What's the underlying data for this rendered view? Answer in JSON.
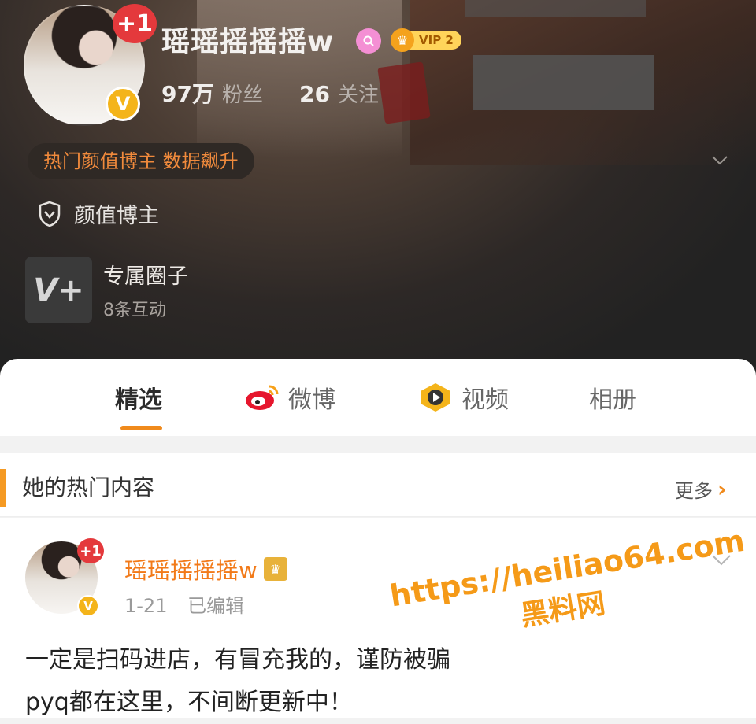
{
  "profile": {
    "username": "瑶瑶摇摇摇w",
    "plus_badge": "+1",
    "verified_badge": "V",
    "vip_label": "VIP 2",
    "fans_count": "97万",
    "fans_label": "粉丝",
    "following_count": "26",
    "following_label": "关注",
    "hot_tag": "热门颜值博主 数据飙升",
    "certification": "颜值博主",
    "circle_title": "专属圈子",
    "circle_sub": "8条互动",
    "circle_icon": "V+",
    "icons": [
      "search-badge-icon",
      "vip-crown-icon",
      "shield-icon",
      "chevron-down-icon"
    ]
  },
  "tabs": [
    {
      "label": "精选",
      "icon": ""
    },
    {
      "label": "微博",
      "icon": "weibo-icon"
    },
    {
      "label": "视频",
      "icon": "video-icon"
    },
    {
      "label": "相册",
      "icon": ""
    }
  ],
  "section": {
    "title": "她的热门内容",
    "more_label": "更多"
  },
  "post": {
    "author": "瑶瑶摇摇摇w",
    "plus_badge": "+1",
    "verified_badge": "V",
    "date": "1-21",
    "edited": "已编辑",
    "text_line1": "一定是扫码进店，有冒充我的，谨防被骗",
    "text_line2": "pyq都在这里，不间断更新中！"
  },
  "watermark": {
    "url": "https://heiliao64.com",
    "site": "黑料网"
  },
  "colors": {
    "accent_orange": "#f08a1c",
    "username_orange": "#f27a19",
    "hot_tag_orange": "#f08a3c",
    "plus_red": "#e4393c",
    "verified_gold": "#f4b41a"
  }
}
